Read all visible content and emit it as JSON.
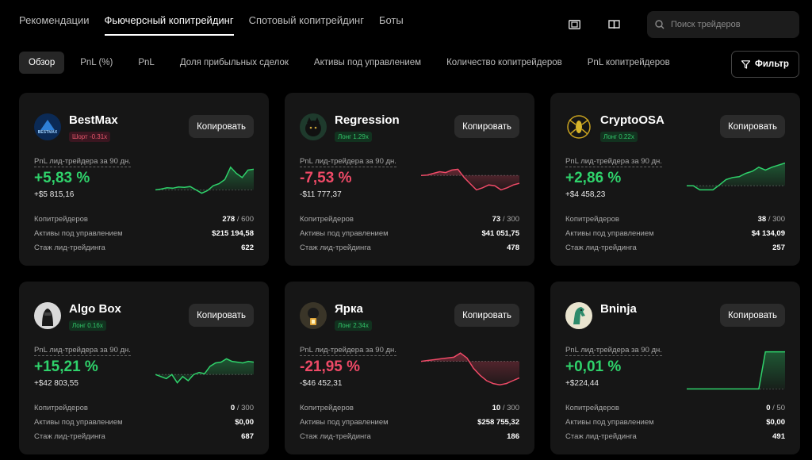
{
  "nav": {
    "tabs": [
      {
        "label": "Рекомендации"
      },
      {
        "label": "Фьючерсный копитрейдинг"
      },
      {
        "label": "Спотовый копитрейдинг"
      },
      {
        "label": "Боты"
      }
    ],
    "active_tab": 1,
    "search_placeholder": "Поиск трейдеров"
  },
  "filters": {
    "chips": [
      {
        "label": "Обзор"
      },
      {
        "label": "PnL (%)"
      },
      {
        "label": "PnL"
      },
      {
        "label": "Доля прибыльных сделок"
      },
      {
        "label": "Активы под управлением"
      },
      {
        "label": "Количество копитрейдеров"
      },
      {
        "label": "PnL копитрейдеров"
      }
    ],
    "active_chip": 0,
    "filter_label": "Фильтр"
  },
  "colors": {
    "positive": "#2fd26b",
    "negative": "#ef4a67",
    "card_bg": "#161616"
  },
  "labels": {
    "copy": "Копировать",
    "pnl_caption": "PnL лид-трейдера за 90 дн.",
    "copiers": "Копитрейдеров",
    "aum": "Активы под управлением",
    "experience": "Стаж лид-трейдинга"
  },
  "traders": [
    {
      "name": "BestMax",
      "badge": "Шорт -0.31x",
      "side": "short",
      "pnl_pct": "+5,83 %",
      "pnl_abs": "+$5 815,16",
      "trend": "pos",
      "copiers": "278",
      "copiers_max": " / 600",
      "aum": "$215 194,58",
      "experience": "622",
      "avatar_icon": "bestmax-logo-icon",
      "spark": [
        0.3,
        0.32,
        0.35,
        0.34,
        0.37,
        0.36,
        0.38,
        0.3,
        0.22,
        0.28,
        0.4,
        0.45,
        0.55,
        0.85,
        0.7,
        0.6,
        0.78,
        0.8
      ]
    },
    {
      "name": "Regression",
      "badge": "Лонг 1.29x",
      "side": "long",
      "pnl_pct": "-7,53 %",
      "pnl_abs": "-$11 777,37",
      "trend": "neg",
      "copiers": "73",
      "copiers_max": " / 300",
      "aum": "$41 051,75",
      "experience": "478",
      "avatar_icon": "wolf-avatar-icon",
      "spark": [
        0.65,
        0.66,
        0.7,
        0.74,
        0.72,
        0.78,
        0.8,
        0.6,
        0.45,
        0.3,
        0.35,
        0.42,
        0.4,
        0.3,
        0.35,
        0.42,
        0.46
      ]
    },
    {
      "name": "CryptoOSA",
      "badge": "Лонг 0.22x",
      "side": "long",
      "pnl_pct": "+2,86 %",
      "pnl_abs": "+$4 458,23",
      "trend": "pos",
      "copiers": "38",
      "copiers_max": " / 300",
      "aum": "$4 134,09",
      "experience": "257",
      "avatar_icon": "wasp-avatar-icon",
      "spark": [
        0.4,
        0.4,
        0.3,
        0.3,
        0.3,
        0.42,
        0.55,
        0.6,
        0.62,
        0.7,
        0.75,
        0.85,
        0.78,
        0.85,
        0.9,
        0.95
      ]
    },
    {
      "name": "Algo Box",
      "badge": "Лонг 0.16x",
      "side": "long",
      "pnl_pct": "+15,21 %",
      "pnl_abs": "+$42 803,55",
      "trend": "pos",
      "copiers": "0",
      "copiers_max": " / 300",
      "aum": "$0,00",
      "experience": "687",
      "avatar_icon": "robot-avatar-icon",
      "spark": [
        0.4,
        0.35,
        0.3,
        0.4,
        0.2,
        0.35,
        0.25,
        0.4,
        0.45,
        0.42,
        0.6,
        0.68,
        0.7,
        0.78,
        0.72,
        0.7,
        0.68,
        0.72,
        0.7
      ]
    },
    {
      "name": "Ярка",
      "badge": "Лонг 2.34x",
      "side": "long",
      "pnl_pct": "-21,95 %",
      "pnl_abs": "-$46 452,31",
      "trend": "neg",
      "copiers": "10",
      "copiers_max": " / 300",
      "aum": "$258 755,32",
      "experience": "186",
      "avatar_icon": "lantern-avatar-icon",
      "spark": [
        0.72,
        0.74,
        0.76,
        0.78,
        0.8,
        0.82,
        0.92,
        0.8,
        0.55,
        0.38,
        0.25,
        0.18,
        0.15,
        0.18,
        0.25,
        0.32
      ]
    },
    {
      "name": "Bninja",
      "badge": "",
      "side": "none",
      "pnl_pct": "+0,01 %",
      "pnl_abs": "+$224,44",
      "trend": "pos",
      "copiers": "0",
      "copiers_max": " / 50",
      "aum": "$0,00",
      "experience": "491",
      "avatar_icon": "horse-avatar-icon",
      "spark": [
        0.05,
        0.05,
        0.05,
        0.05,
        0.05,
        0.05,
        0.05,
        0.05,
        0.05,
        0.05,
        0.05,
        0.05,
        0.95,
        0.95,
        0.95,
        0.95
      ]
    }
  ]
}
